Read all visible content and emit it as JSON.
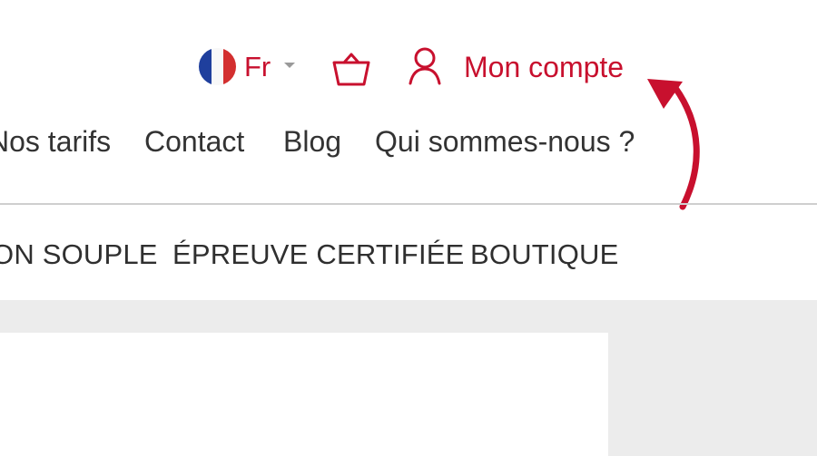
{
  "colors": {
    "brand": "#c8102e",
    "text": "#333333",
    "muted": "#9a9a9a",
    "divider": "#cfcfcf",
    "content_bg": "#ececec",
    "flag_blue": "#1f3f9d",
    "flag_white": "#f8f8f8",
    "flag_red": "#d32f2f"
  },
  "header": {
    "language": {
      "label": "Fr",
      "icon": "france-flag-icon",
      "dropdown_icon": "chevron-down-icon"
    },
    "cart": {
      "icon": "shopping-basket-icon"
    },
    "account": {
      "icon": "user-icon",
      "label": "Mon compte"
    }
  },
  "secondary_nav": {
    "items": [
      {
        "label": "Nos tarifs"
      },
      {
        "label": "Contact"
      },
      {
        "label": "Blog"
      },
      {
        "label": "Qui sommes-nous ?"
      }
    ]
  },
  "main_nav": {
    "items": [
      {
        "label": "ON SOUPLE"
      },
      {
        "label": "ÉPREUVE CERTIFIÉE"
      },
      {
        "label": "BOUTIQUE"
      }
    ]
  },
  "annotation": {
    "icon": "curved-arrow-icon"
  }
}
